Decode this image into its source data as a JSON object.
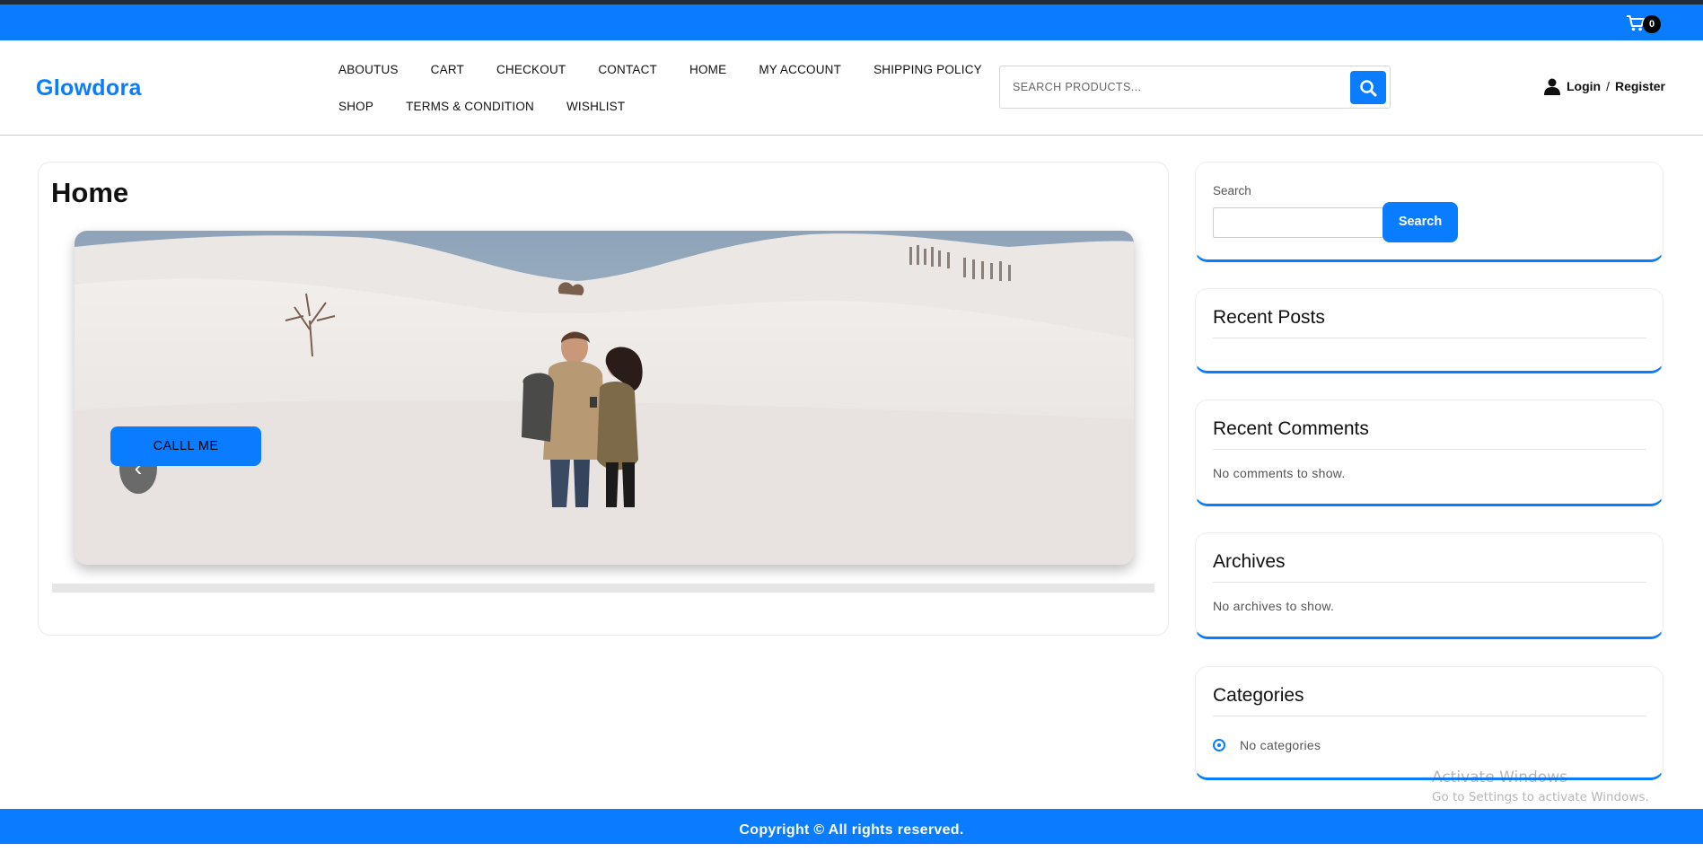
{
  "topbar": {
    "cart_count": "0"
  },
  "header": {
    "logo": "Glowdora",
    "nav_row1": [
      "ABOUTUS",
      "CART",
      "CHECKOUT",
      "CONTACT",
      "HOME",
      "MY ACCOUNT",
      "SHIPPING POLICY"
    ],
    "nav_row2": [
      "SHOP",
      "TERMS & CONDITION",
      "WISHLIST"
    ],
    "search_placeholder": "SEARCH PRODUCTS...",
    "login": "Login",
    "separator": "/",
    "register": "Register"
  },
  "main": {
    "title": "Home",
    "slider": {
      "cta_label": "CALLL ME",
      "prev_symbol": "‹",
      "next_symbol": "›"
    }
  },
  "sidebar": {
    "search": {
      "label": "Search",
      "button": "Search"
    },
    "recent_posts": {
      "title": "Recent Posts"
    },
    "recent_comments": {
      "title": "Recent Comments",
      "empty": "No comments to show."
    },
    "archives": {
      "title": "Archives",
      "empty": "No archives to show."
    },
    "categories": {
      "title": "Categories",
      "empty": "No categories"
    }
  },
  "footer": {
    "copyright": "Copyright ©  All rights reserved."
  },
  "watermark": {
    "line1": "Activate Windows",
    "line2": "Go to Settings to activate Windows."
  },
  "colors": {
    "accent": "#0a7cff",
    "topstrip": "#1f2d3a"
  }
}
